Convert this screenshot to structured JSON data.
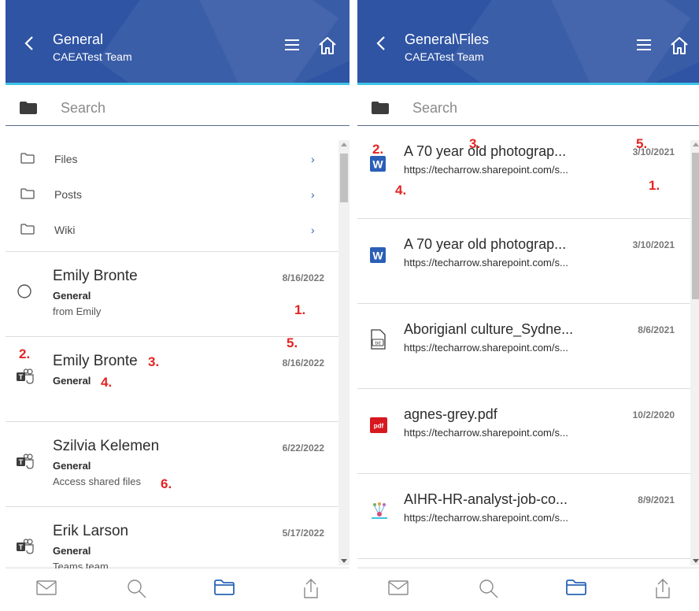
{
  "left": {
    "header": {
      "title": "General",
      "subtitle": "CAEATest Team"
    },
    "search": {
      "placeholder": "Search"
    },
    "folders": [
      {
        "label": "Files"
      },
      {
        "label": "Posts"
      },
      {
        "label": "Wiki"
      }
    ],
    "items": [
      {
        "title": "Emily Bronte",
        "channel": "General",
        "detail": "from Emily",
        "date": "8/16/2022",
        "icon": "circle-icon"
      },
      {
        "title": "Emily Bronte",
        "channel": "General",
        "detail": "",
        "date": "8/16/2022",
        "icon": "teams-icon"
      },
      {
        "title": "Szilvia Kelemen",
        "channel": "General",
        "detail": "Access shared files",
        "date": "6/22/2022",
        "icon": "teams-icon"
      },
      {
        "title": "Erik Larson",
        "channel": "General",
        "detail": "Teams team",
        "date": "5/17/2022",
        "icon": "teams-icon"
      }
    ],
    "markers": [
      "1.",
      "2.",
      "3.",
      "4.",
      "5.",
      "6."
    ]
  },
  "right": {
    "header": {
      "title": "General\\Files",
      "subtitle": "CAEATest Team"
    },
    "search": {
      "placeholder": "Search"
    },
    "files": [
      {
        "title": "A 70 year old photograp...",
        "url": "https://techarrow.sharepoint.com/s...",
        "date": "3/10/2021",
        "icon": "word-icon"
      },
      {
        "title": "A 70 year old photograp...",
        "url": "https://techarrow.sharepoint.com/s...",
        "date": "3/10/2021",
        "icon": "word-icon"
      },
      {
        "title": "Aborigianl culture_Sydne...",
        "url": "https://techarrow.sharepoint.com/s...",
        "date": "8/6/2021",
        "icon": "txt-file-icon"
      },
      {
        "title": "agnes-grey.pdf",
        "url": "https://techarrow.sharepoint.com/s...",
        "date": "10/2/2020",
        "icon": "pdf-icon"
      },
      {
        "title": "AIHR-HR-analyst-job-co...",
        "url": "https://techarrow.sharepoint.com/s...",
        "date": "8/9/2021",
        "icon": "image-file-icon"
      }
    ],
    "markers": [
      "1.",
      "2.",
      "3.",
      "4.",
      "5."
    ]
  },
  "icons": {
    "word_letter": "W",
    "pdf_letter": "pdf",
    "txt_letter": "txt",
    "teams_letter": "T"
  },
  "colors": {
    "header": "#2f54a3",
    "header_accent": "#3ec3e8",
    "link": "#2b64b5",
    "marker": "#e52323"
  }
}
